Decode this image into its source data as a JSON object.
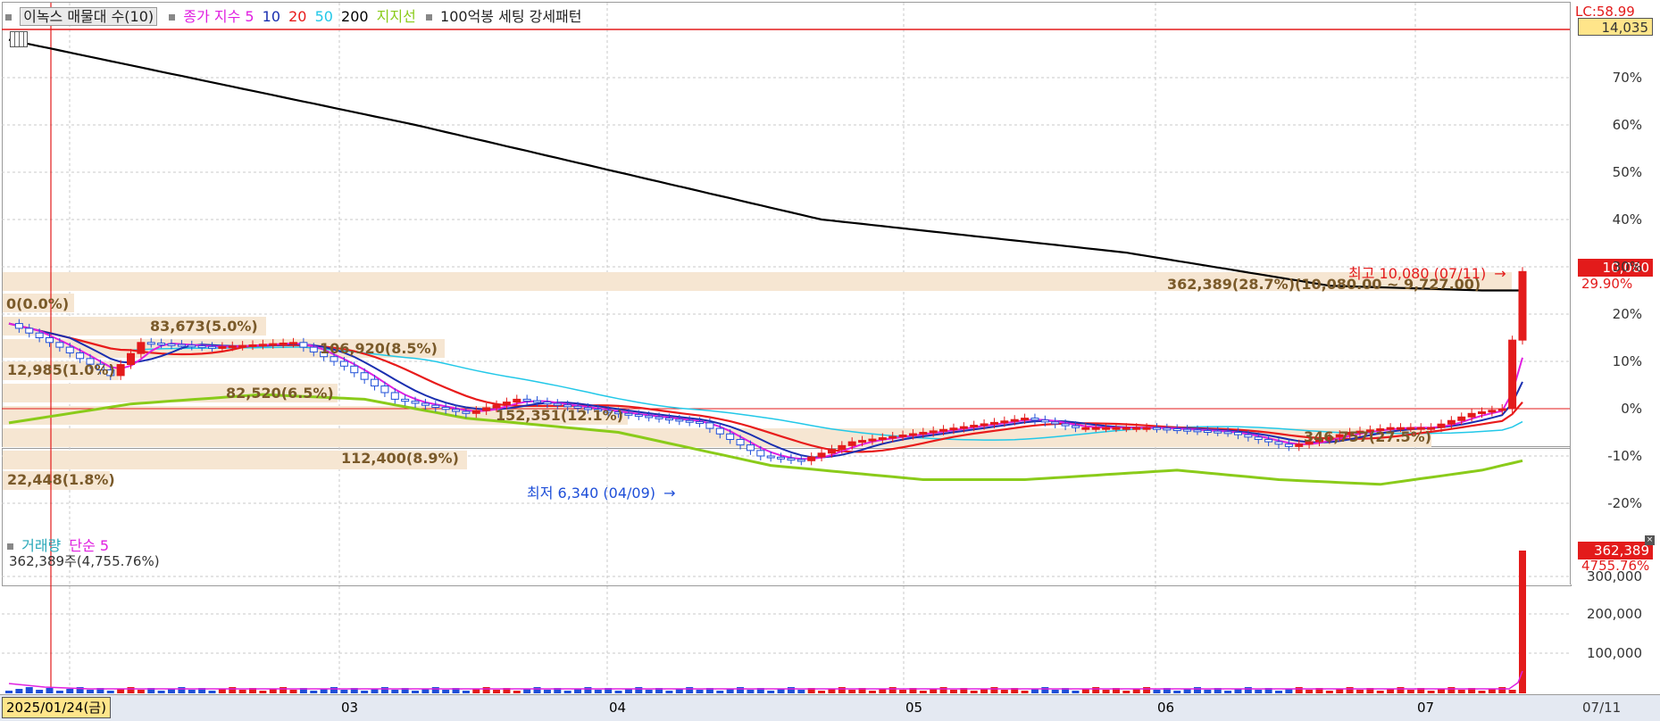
{
  "top_legend": {
    "toggle_icon": "square-icon",
    "title": "이녹스 매물대 수(10)",
    "price_ma_label": "종가 지수 5",
    "ma10": "10",
    "ma20": "20",
    "ma50": "50",
    "ma200": "200",
    "support_label": "지지선",
    "pattern_label": "100억봉 세팅 강세패턴"
  },
  "right_panel": {
    "lc_label": "LC:58.99",
    "price_tag": "14,035",
    "high_tag": "10,080",
    "high_pct_tag": "29.90%",
    "pct_ticks": [
      "70%",
      "60%",
      "50%",
      "40%",
      "30%",
      "20%",
      "10%",
      "0%",
      "-10%",
      "-20%"
    ],
    "vol_tag": "362,389",
    "vol_pct_tag": "4755.76%",
    "vol_ticks": [
      "300,000",
      "200,000",
      "100,000"
    ]
  },
  "volume_profile": [
    {
      "label": "0(0.0%)"
    },
    {
      "label": "83,673(5.0%)"
    },
    {
      "label": "106,920(8.5%)"
    },
    {
      "label": "12,985(1.0%)"
    },
    {
      "label": "82,520(6.5%)"
    },
    {
      "label": "152,351(12.1%)"
    },
    {
      "label": "112,400(8.9%)"
    },
    {
      "label": "22,448(1.8%)"
    },
    {
      "label": "362,389(28.7%)(10,080.00 ~ 9,727.00)"
    },
    {
      "label": "346,757(27.5%)"
    }
  ],
  "annotations": {
    "high": "최고 10,080 (07/11)",
    "low": "최저 6,340 (04/09)"
  },
  "volume_legend": {
    "label": "거래량",
    "ma_label": "단순 5",
    "value_text": "362,389주(4,755.76%)"
  },
  "x_axis": {
    "date_box": "2025/01/24(금)",
    "months": [
      "03",
      "04",
      "05",
      "06",
      "07"
    ],
    "right_date": "07/11"
  },
  "colors": {
    "up": "#e31b1b",
    "down": "#1f4fd8",
    "ma5": "#e020e0",
    "ma10": "#1a2fb0",
    "ma20": "#e81b1b",
    "ma50": "#22c8e8",
    "ma200": "#000000",
    "support": "#8acb1a",
    "profile_bar": "#f6e6d2",
    "profile_text": "#7a5a2a",
    "tag_red": "#e31b1b",
    "tag_yellow": "#ffe58a"
  }
}
